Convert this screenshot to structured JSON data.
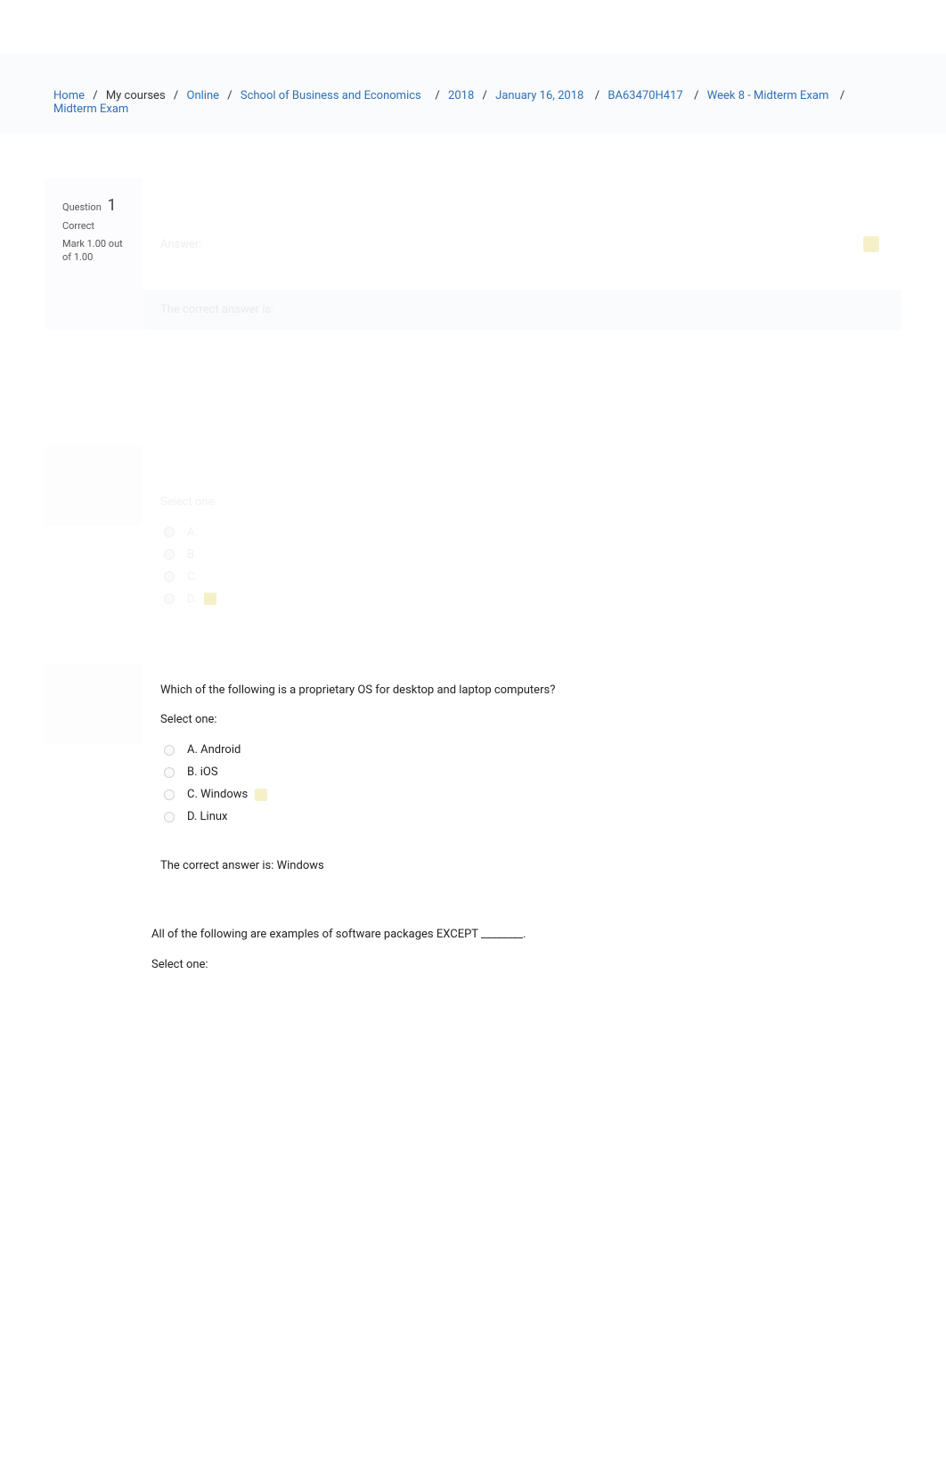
{
  "breadcrumb": {
    "home": "Home",
    "my_courses": "My courses",
    "online": "Online",
    "school": "School of Business and Economics",
    "year": "2018",
    "date": "January 16, 2018",
    "course": "BA63470H417",
    "week": "Week 8 - Midterm Exam",
    "activity": "Midterm Exam"
  },
  "q1": {
    "question_label": "Question",
    "number": "1",
    "status": "Correct",
    "mark": "Mark 1.00 out of 1.00",
    "answer_placeholder": "Answer:",
    "feedback_placeholder": "The correct answer is:"
  },
  "q2": {
    "select_one": "Select one:",
    "optA": "A.",
    "optB": "B.",
    "optC": "C.",
    "optD": "D."
  },
  "q3": {
    "text": "Which of the following is a proprietary OS for desktop and laptop computers?",
    "select_one": "Select one:",
    "optA": "A. Android",
    "optB": "B. iOS",
    "optC": "C. Windows",
    "optD": "D. Linux",
    "feedback": "The correct answer is: Windows"
  },
  "q4": {
    "text": "All of the following are examples of software packages EXCEPT ________.",
    "select_one": "Select one:"
  }
}
